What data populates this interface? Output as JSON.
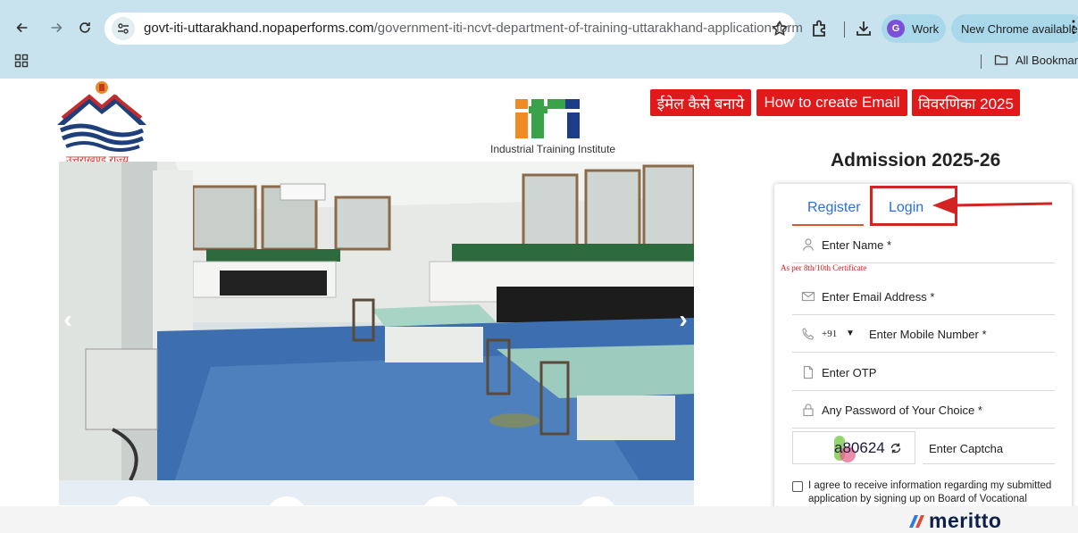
{
  "browser": {
    "url_host": "govt-iti-uttarakhand.nopaperforms.com",
    "url_path": "/government-iti-ncvt-department-of-training-uttarakhand-application-form",
    "profile_initial": "G",
    "profile_label": "Work",
    "update_label": "New Chrome available",
    "all_bookmarks": "All Bookmarks",
    "icons": [
      "back-icon",
      "forward-icon",
      "reload-icon",
      "site-info-icon",
      "star-icon",
      "extensions-icon",
      "download-icon",
      "apps-icon",
      "folder-icon"
    ]
  },
  "header": {
    "state_name": "उत्तराखण्ड राज्य",
    "iti_tagline": "Industrial Training Institute",
    "buttons": [
      "ईमेल कैसे बनाये",
      "How to create Email",
      "विवरणिका 2025"
    ],
    "admission_title": "Admission 2025-26"
  },
  "carousel": {
    "prev_glyph": "‹",
    "next_glyph": "›"
  },
  "form": {
    "tabs": {
      "register": "Register",
      "login": "Login"
    },
    "name_label": "Enter Name *",
    "name_hint": "As per 8th/10th Certificate",
    "email_label": "Enter Email Address *",
    "dial_code": "+91",
    "mobile_label": "Enter Mobile Number *",
    "otp_label": "Enter OTP",
    "password_label": "Any Password of Your Choice *",
    "captcha_value": "a80624",
    "captcha_label": "Enter Captcha",
    "agree_text": "I agree to receive information regarding my submitted application by signing up on Board of Vocational"
  },
  "footer": {
    "brand": "meritto"
  },
  "colors": {
    "chrome_bar": "#c9e3ee",
    "red_button": "#e01a1a",
    "tab_blue": "#2a6fdb",
    "highlight_red": "#d42323",
    "brand_navy": "#0d1f4a"
  }
}
